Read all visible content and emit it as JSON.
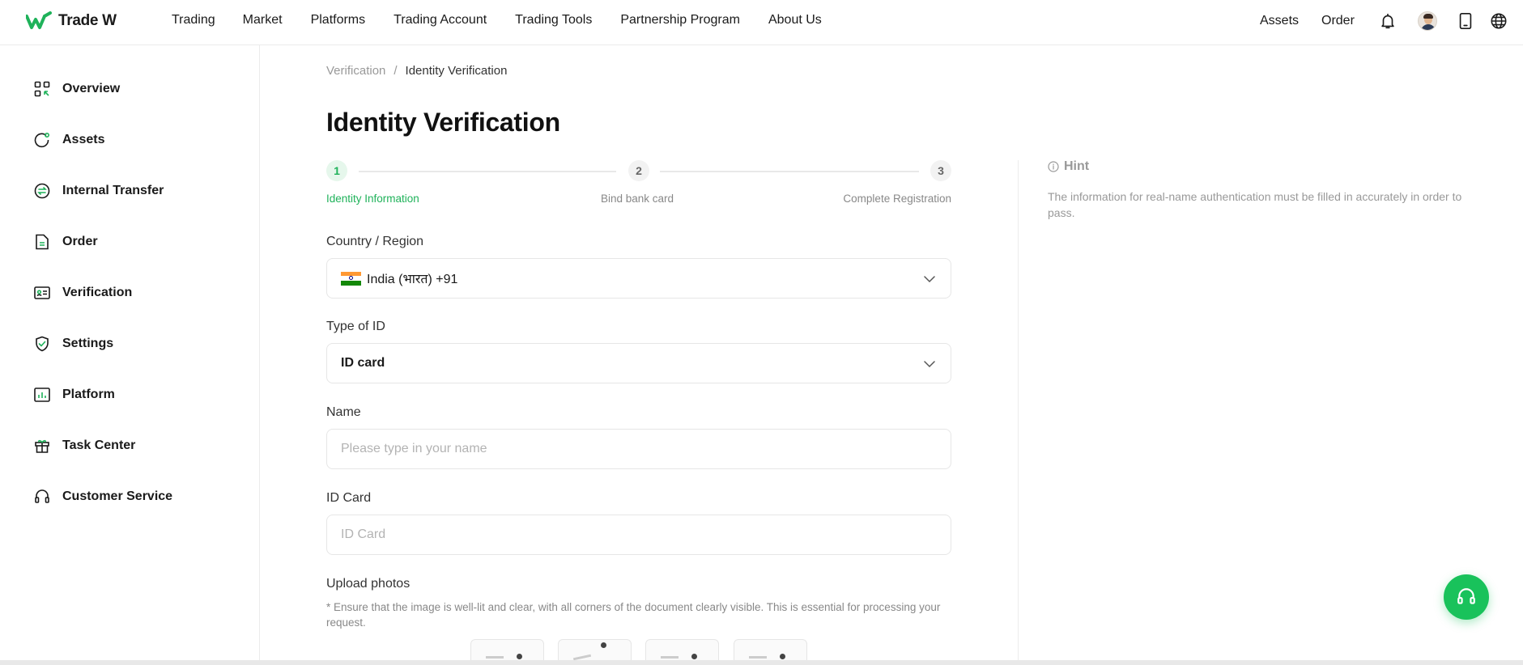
{
  "brand": {
    "name": "Trade W",
    "accent": "#1fb25a",
    "fab_color": "#19c25b"
  },
  "nav": [
    "Trading",
    "Market",
    "Platforms",
    "Trading Account",
    "Trading Tools",
    "Partnership Program",
    "About Us"
  ],
  "header_right": {
    "assets": "Assets",
    "order": "Order",
    "icons": [
      "bell-icon",
      "avatar",
      "phone-icon",
      "globe-icon"
    ]
  },
  "sidebar": {
    "items": [
      {
        "label": "Overview",
        "icon": "overview-icon"
      },
      {
        "label": "Assets",
        "icon": "assets-icon"
      },
      {
        "label": "Internal Transfer",
        "icon": "transfer-icon"
      },
      {
        "label": "Order",
        "icon": "order-icon"
      },
      {
        "label": "Verification",
        "icon": "verification-icon"
      },
      {
        "label": "Settings",
        "icon": "shield-icon"
      },
      {
        "label": "Platform",
        "icon": "platform-icon"
      },
      {
        "label": "Task Center",
        "icon": "gift-icon"
      },
      {
        "label": "Customer Service",
        "icon": "headset-icon"
      }
    ]
  },
  "breadcrumb": {
    "parent": "Verification",
    "separator": "/",
    "current": "Identity Verification"
  },
  "page": {
    "title": "Identity Verification"
  },
  "steps": [
    {
      "num": "1",
      "label": "Identity Information",
      "state": "active"
    },
    {
      "num": "2",
      "label": "Bind bank card",
      "state": "inactive"
    },
    {
      "num": "3",
      "label": "Complete Registration",
      "state": "inactive"
    }
  ],
  "form": {
    "country": {
      "label": "Country / Region",
      "value": "India (भारत) +91"
    },
    "id_type": {
      "label": "Type of ID",
      "value": "ID card"
    },
    "name": {
      "label": "Name",
      "placeholder": "Please type in your name",
      "value": ""
    },
    "id_card": {
      "label": "ID Card",
      "placeholder": "ID Card",
      "value": ""
    },
    "upload": {
      "label": "Upload photos",
      "note": "* Ensure that the image is well-lit and clear, with all corners of the document clearly visible. This is essential for processing your request."
    }
  },
  "hint": {
    "title": "Hint",
    "text": "The information for real-name authentication must be filled in accurately in order to pass."
  }
}
